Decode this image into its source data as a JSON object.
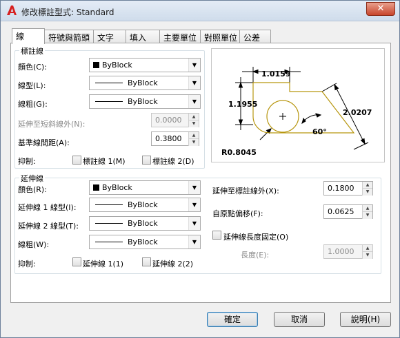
{
  "window": {
    "title": "修改標註型式: Standard",
    "close_glyph": "✕"
  },
  "tabs": [
    {
      "label": "線"
    },
    {
      "label": "符號與箭頭"
    },
    {
      "label": "文字"
    },
    {
      "label": "填入"
    },
    {
      "label": "主要單位"
    },
    {
      "label": "對照單位"
    },
    {
      "label": "公差"
    }
  ],
  "dim_lines": {
    "group_label": "標註線",
    "color_label": "顏色(C):",
    "color_value": "ByBlock",
    "linetype_label": "線型(L):",
    "linetype_value": "ByBlock",
    "lineweight_label": "線粗(G):",
    "lineweight_value": "ByBlock",
    "extend_ticks_label": "延伸至短斜線外(N):",
    "extend_ticks_value": "0.0000",
    "baseline_spacing_label": "基準線間距(A):",
    "baseline_spacing_value": "0.3800",
    "suppress_label": "抑制:",
    "suppress_1_label": "標註線 1(M)",
    "suppress_2_label": "標註線 2(D)"
  },
  "ext_lines": {
    "group_label": "延伸線",
    "color_label": "顏色(R):",
    "color_value": "ByBlock",
    "linetype1_label": "延伸線 1 線型(I):",
    "linetype1_value": "ByBlock",
    "linetype2_label": "延伸線 2 線型(T):",
    "linetype2_value": "ByBlock",
    "lineweight_label": "線粗(W):",
    "lineweight_value": "ByBlock",
    "suppress_label": "抑制:",
    "suppress_1_label": "延伸線 1(1)",
    "suppress_2_label": "延伸線 2(2)",
    "extend_beyond_label": "延伸至標註線外(X):",
    "extend_beyond_value": "0.1800",
    "offset_label": "自原點偏移(F):",
    "offset_value": "0.0625",
    "fixed_length_label": "延伸線長度固定(O)",
    "length_label": "長度(E):",
    "length_value": "1.0000"
  },
  "preview": {
    "dim_top": "1.0159",
    "dim_left": "1.1955",
    "dim_right": "2.0207",
    "dim_angle": "60°",
    "dim_radius": "R0.8045"
  },
  "buttons": {
    "ok": "確定",
    "cancel": "取消",
    "help": "說明(H)"
  },
  "colors": {
    "preview_outline": "#b7960f",
    "accent": "#3c7fb1"
  }
}
